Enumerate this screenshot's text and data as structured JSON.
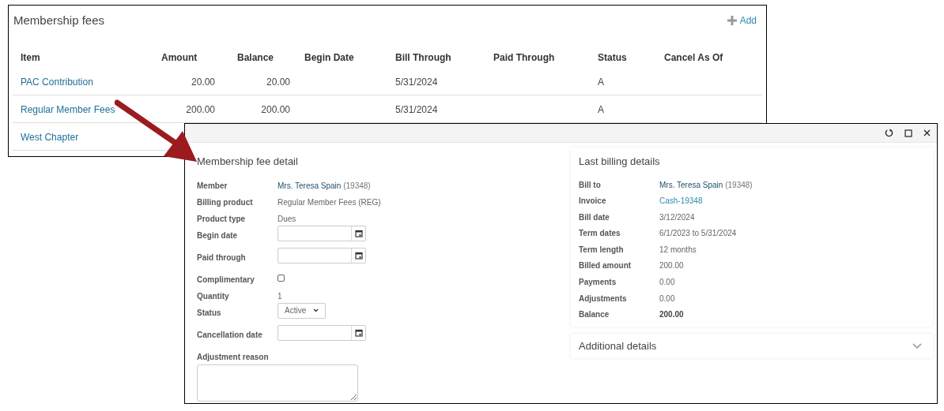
{
  "fees_panel": {
    "title": "Membership fees",
    "add_label": "Add",
    "columns": [
      "Item",
      "Amount",
      "Balance",
      "Begin Date",
      "Bill Through",
      "Paid Through",
      "Status",
      "Cancel As Of"
    ],
    "rows": [
      {
        "item": "PAC Contribution",
        "amount": "20.00",
        "balance": "20.00",
        "bill_through": "5/31/2024",
        "status": "A"
      },
      {
        "item": "Regular Member Fees",
        "amount": "200.00",
        "balance": "200.00",
        "bill_through": "5/31/2024",
        "status": "A"
      },
      {
        "item": "West Chapter"
      }
    ]
  },
  "dialog": {
    "fee_detail": {
      "title": "Membership fee detail",
      "fields": [
        {
          "kind": "link",
          "label": "Member",
          "value": "Mrs. Teresa Spain",
          "suffix": "(19348)"
        },
        {
          "kind": "text",
          "label": "Billing product",
          "value": "Regular Member Fees (REG)"
        },
        {
          "kind": "text",
          "label": "Product type",
          "value": "Dues"
        },
        {
          "kind": "date",
          "label": "Begin date"
        },
        {
          "kind": "date",
          "label": "Paid through"
        },
        {
          "kind": "checkbox",
          "label": "Complimentary",
          "checked": false
        },
        {
          "kind": "text",
          "label": "Quantity",
          "value": "1"
        },
        {
          "kind": "select",
          "label": "Status",
          "value": "Active"
        },
        {
          "kind": "date",
          "label": "Cancellation date"
        },
        {
          "kind": "textarea",
          "label": "Adjustment reason"
        }
      ]
    },
    "billing": {
      "title": "Last billing details",
      "fields": [
        {
          "kind": "name",
          "label": "Bill to",
          "value": "Mrs. Teresa Spain",
          "suffix": "(19348)"
        },
        {
          "kind": "link",
          "label": "Invoice",
          "value": "Cash-19348"
        },
        {
          "kind": "text",
          "label": "Bill date",
          "value": "3/12/2024"
        },
        {
          "kind": "text",
          "label": "Term dates",
          "value": "6/1/2023 to 5/31/2024"
        },
        {
          "kind": "text",
          "label": "Term length",
          "value": "12 months"
        },
        {
          "kind": "text",
          "label": "Billed amount",
          "value": "200.00"
        },
        {
          "kind": "text",
          "label": "Payments",
          "value": "0.00"
        },
        {
          "kind": "text",
          "label": "Adjustments",
          "value": "0.00"
        },
        {
          "kind": "bold",
          "label": "Balance",
          "value": "200.00"
        }
      ]
    },
    "additional": {
      "title": "Additional details",
      "expanded": false
    }
  }
}
